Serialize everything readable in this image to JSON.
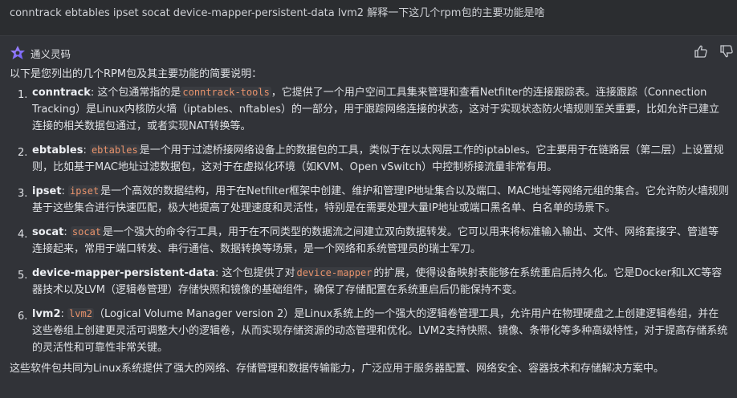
{
  "question": "conntrack ebtables ipset socat device-mapper-persistent-data lvm2 解释一下这几个rpm包的主要功能是啥",
  "assistant": {
    "name": "通义灵码",
    "logo_icon": "tongyi-logo-icon"
  },
  "feedback": {
    "like_icon": "thumbs-up-icon",
    "dislike_icon": "thumbs-down-icon"
  },
  "intro": "以下是您列出的几个RPM包及其主要功能的简要说明：",
  "items": [
    {
      "num": "1.",
      "name": "conntrack",
      "sep": ": 这个包通常指的是",
      "code": "conntrack-tools",
      "text": "，它提供了一个用户空间工具集来管理和查看Netfilter的连接跟踪表。连接跟踪（Connection Tracking）是Linux内核防火墙（iptables、nftables）的一部分，用于跟踪网络连接的状态，这对于实现状态防火墙规则至关重要，比如允许已建立连接的相关数据包通过，或者实现NAT转换等。"
    },
    {
      "num": "2.",
      "name": "ebtables",
      "sep": ": ",
      "code": "ebtables",
      "text": "是一个用于过滤桥接网络设备上的数据包的工具，类似于在以太网层工作的iptables。它主要用于在链路层（第二层）上设置规则，比如基于MAC地址过滤数据包，这对于在虚拟化环境（如KVM、Open vSwitch）中控制桥接流量非常有用。"
    },
    {
      "num": "3.",
      "name": "ipset",
      "sep": ": ",
      "code": "ipset",
      "text": "是一个高效的数据结构，用于在Netfilter框架中创建、维护和管理IP地址集合以及端口、MAC地址等网络元组的集合。它允许防火墙规则基于这些集合进行快速匹配，极大地提高了处理速度和灵活性，特别是在需要处理大量IP地址或端口黑名单、白名单的场景下。"
    },
    {
      "num": "4.",
      "name": "socat",
      "sep": ": ",
      "code": "socat",
      "text": "是一个强大的命令行工具，用于在不同类型的数据流之间建立双向数据转发。它可以用来将标准输入输出、文件、网络套接字、管道等连接起来，常用于端口转发、串行通信、数据转换等场景，是一个网络和系统管理员的瑞士军刀。"
    },
    {
      "num": "5.",
      "name": "device-mapper-persistent-data",
      "sep": ": 这个包提供了对",
      "code": "device-mapper",
      "text": "的扩展，使得设备映射表能够在系统重启后持久化。它是Docker和LXC等容器技术以及LVM（逻辑卷管理）存储快照和镜像的基础组件，确保了存储配置在系统重启后仍能保持不变。"
    },
    {
      "num": "6.",
      "name": "lvm2",
      "sep": ": ",
      "code": "lvm2",
      "text": "（Logical Volume Manager version 2）是Linux系统上的一个强大的逻辑卷管理工具，允许用户在物理硬盘之上创建逻辑卷组，并在这些卷组上创建更灵活可调整大小的逻辑卷，从而实现存储资源的动态管理和优化。LVM2支持快照、镜像、条带化等多种高级特性，对于提高存储系统的灵活性和可靠性非常关键。"
    }
  ],
  "outro": "这些软件包共同为Linux系统提供了强大的网络、存储管理和数据传输能力，广泛应用于服务器配置、网络安全、容器技术和存储解决方案中。",
  "colors": {
    "background": "#2b2d30",
    "answer_bg": "#313338",
    "code_text": "#e9936c",
    "text": "#dfe1e5"
  }
}
